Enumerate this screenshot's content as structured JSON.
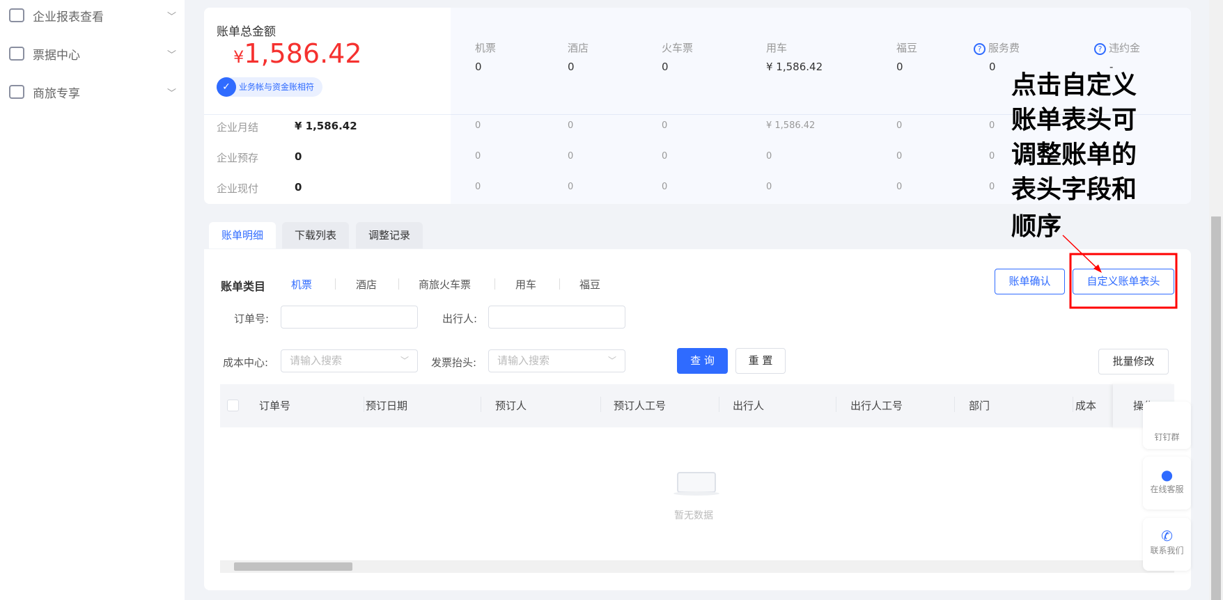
{
  "sidebar": {
    "items": [
      {
        "label": "企业报表查看",
        "icon": "megaphone-icon"
      },
      {
        "label": "票据中心",
        "icon": "ticket-icon"
      },
      {
        "label": "商旅专享",
        "icon": "gift-icon"
      }
    ]
  },
  "summary": {
    "total_label": "账单总金额",
    "currency": "¥",
    "total": "1,586.42",
    "badge": "业务帐与资金账相符",
    "columns": [
      {
        "label": "机票",
        "value": "0"
      },
      {
        "label": "酒店",
        "value": "0"
      },
      {
        "label": "火车票",
        "value": "0"
      },
      {
        "label": "用车",
        "value": "¥ 1,586.42"
      },
      {
        "label": "福豆",
        "value": "0"
      },
      {
        "label": "服务费",
        "value": "0",
        "help": true
      },
      {
        "label": "违约金",
        "value": "-",
        "help": true
      }
    ],
    "rows": [
      {
        "label": "企业月结",
        "value": "¥ 1,586.42",
        "cells": [
          "0",
          "0",
          "0",
          "¥ 1,586.42",
          "0",
          "0"
        ]
      },
      {
        "label": "企业预存",
        "value": "0",
        "cells": [
          "0",
          "0",
          "0",
          "0",
          "0",
          "0"
        ]
      },
      {
        "label": "企业现付",
        "value": "0",
        "cells": [
          "0",
          "0",
          "0",
          "0",
          "0",
          "0"
        ]
      }
    ]
  },
  "tabs": [
    {
      "label": "账单明细",
      "active": true
    },
    {
      "label": "下载列表"
    },
    {
      "label": "调整记录"
    }
  ],
  "category": {
    "title": "账单类目",
    "items": [
      "机票",
      "酒店",
      "商旅火车票",
      "用车",
      "福豆"
    ],
    "active": "机票"
  },
  "filters": {
    "order_no_label": "订单号:",
    "traveler_label": "出行人:",
    "cost_center_label": "成本中心:",
    "cost_center_placeholder": "请输入搜索",
    "invoice_label": "发票抬头:",
    "invoice_placeholder": "请输入搜索"
  },
  "buttons": {
    "query": "查 询",
    "reset": "重 置",
    "batch": "批量修改",
    "confirm": "账单确认",
    "custom_header": "自定义账单表头"
  },
  "table": {
    "columns": [
      "订单号",
      "预订日期",
      "预订人",
      "预订人工号",
      "出行人",
      "出行人工号",
      "部门",
      "成本"
    ],
    "action_column": "操作",
    "empty": "暂无数据"
  },
  "floats": [
    {
      "label": "钉钉群"
    },
    {
      "label": "在线客服",
      "icon": "headset-icon"
    },
    {
      "label": "联系我们",
      "icon": "phone-icon"
    }
  ],
  "annotation": {
    "lines": [
      "点击自定义",
      "账单表头可",
      "调整账单的",
      "表头字段和",
      "顺序"
    ]
  },
  "colors": {
    "accent": "#2f6bff",
    "amount": "#f5312f",
    "highlight": "#ff0000"
  }
}
